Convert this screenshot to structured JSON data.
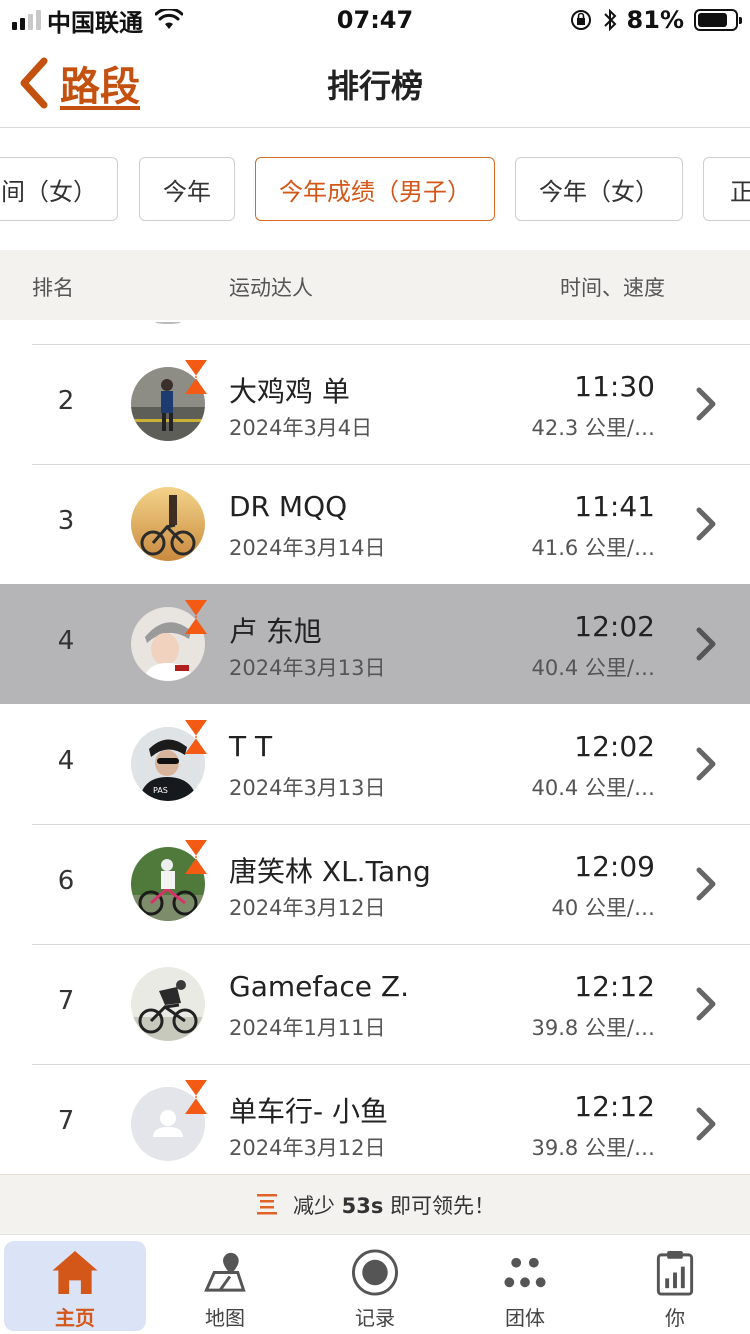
{
  "status_bar": {
    "carrier": "中国联通",
    "time": "07:47",
    "battery": "81%",
    "battery_level": 0.81
  },
  "header": {
    "back_label": "路段",
    "title": "排行榜"
  },
  "filters": [
    {
      "label": "间（女）",
      "active": false
    },
    {
      "label": "今年",
      "active": false
    },
    {
      "label": "今年成绩（男子）",
      "active": true
    },
    {
      "label": "今年（女）",
      "active": false
    },
    {
      "label": "正",
      "active": false
    }
  ],
  "columns": {
    "rank": "排名",
    "athlete": "运动达人",
    "time_speed": "时间、速度"
  },
  "entries": [
    {
      "rank": "2",
      "name": "大鸡鸡 单",
      "date": "2024年3月4日",
      "time": "11:30",
      "speed": "42.3 公里/…",
      "highlight": false,
      "badge": true
    },
    {
      "rank": "3",
      "name": "DR MQQ",
      "date": "2024年3月14日",
      "time": "11:41",
      "speed": "41.6 公里/…",
      "highlight": false,
      "badge": false
    },
    {
      "rank": "4",
      "name": "卢 东旭",
      "date": "2024年3月13日",
      "time": "12:02",
      "speed": "40.4 公里/…",
      "highlight": true,
      "badge": true
    },
    {
      "rank": "4",
      "name": "T T",
      "date": "2024年3月13日",
      "time": "12:02",
      "speed": "40.4 公里/…",
      "highlight": false,
      "badge": true
    },
    {
      "rank": "6",
      "name": "唐笑林 XL.Tang",
      "date": "2024年3月12日",
      "time": "12:09",
      "speed": "40 公里/…",
      "highlight": false,
      "badge": true
    },
    {
      "rank": "7",
      "name": "Gameface Z.",
      "date": "2024年1月11日",
      "time": "12:12",
      "speed": "39.8 公里/…",
      "highlight": false,
      "badge": false
    },
    {
      "rank": "7",
      "name": "单车行- 小鱼",
      "date": "2024年3月12日",
      "time": "12:12",
      "speed": "39.8 公里/…",
      "highlight": false,
      "badge": true
    }
  ],
  "tip": {
    "prefix": "减少",
    "amount": "53s",
    "suffix": "即可领先！"
  },
  "tabs": [
    {
      "label": "主页",
      "icon": "home-icon",
      "active": true
    },
    {
      "label": "地图",
      "icon": "map-icon",
      "active": false
    },
    {
      "label": "记录",
      "icon": "record-icon",
      "active": false
    },
    {
      "label": "团体",
      "icon": "groups-icon",
      "active": false
    },
    {
      "label": "你",
      "icon": "profile-stats-icon",
      "active": false
    }
  ],
  "colors": {
    "accent": "#d4571a",
    "highlight_row": "#b5b5b8",
    "tab_active_bg": "#dbe4f6"
  }
}
